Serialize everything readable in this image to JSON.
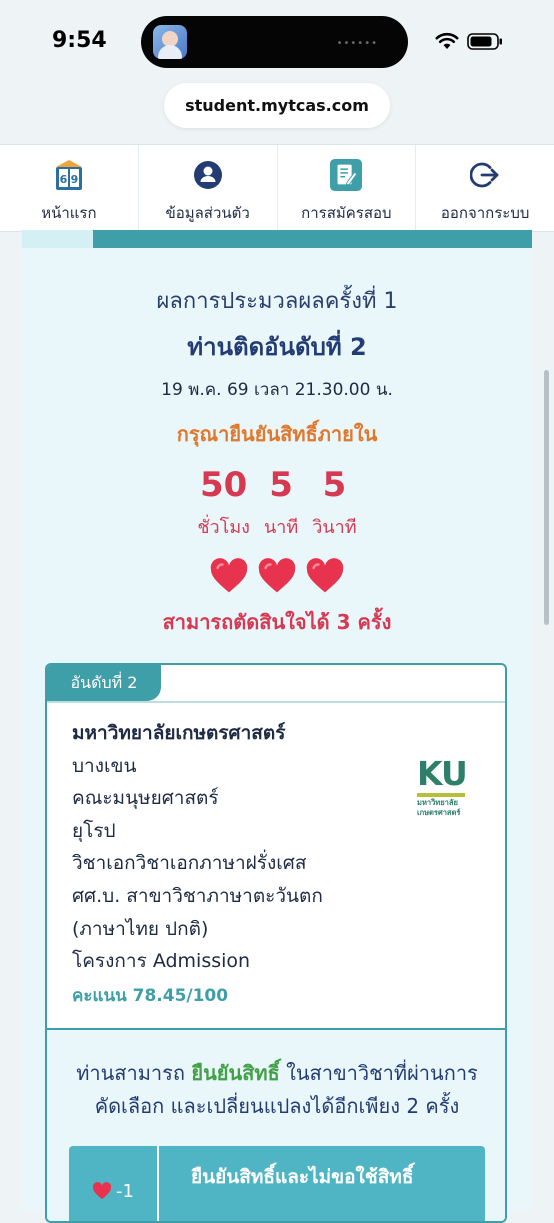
{
  "status_bar": {
    "time": "9:54"
  },
  "browser": {
    "url": "student.mytcas.com"
  },
  "nav": {
    "items": [
      {
        "label": "หน้าแรก",
        "icon": "book-69-icon",
        "badge_left": "6",
        "badge_right": "9"
      },
      {
        "label": "ข้อมูลส่วนตัว",
        "icon": "user-circle-icon"
      },
      {
        "label": "การสมัครสอบ",
        "icon": "edit-document-icon"
      },
      {
        "label": "ออกจากระบบ",
        "icon": "logout-icon"
      }
    ]
  },
  "result": {
    "round_title": "ผลการประมวลผลครั้งที่ 1",
    "rank_title": "ท่านติดอันดับที่ 2",
    "deadline": "19 พ.ค. 69 เวลา 21.30.00 น.",
    "confirm_label": "กรุณายืนยันสิทธิ์ภายใน",
    "countdown": {
      "hours": "50",
      "hours_unit": "ชั่วโมง",
      "minutes": "5",
      "minutes_unit": "นาที",
      "seconds": "5",
      "seconds_unit": "วินาที"
    },
    "hearts_count": 3,
    "chances_text": "สามารถตัดสินใจได้ 3 ครั้ง"
  },
  "card": {
    "rank_tab": "อันดับที่ 2",
    "university": "มหาวิทยาลัยเกษตรศาสตร์",
    "campus": "บางเขน",
    "faculty": "คณะมนุษยศาสตร์",
    "field": "ยุโรป",
    "major": "วิชาเอกวิชาเอกภาษาฝรั่งเศส",
    "degree": "ศศ.บ. สาขาวิชาภาษาตะวันตก",
    "program": "(ภาษาไทย ปกติ)",
    "project": "โครงการ Admission",
    "score": "คะแนน 78.45/100",
    "logo": {
      "letters": "KU",
      "line1": "มหาวิทยาลัย",
      "line2": "เกษตรศาสตร์"
    },
    "info": {
      "before": "ท่านสามารถ ",
      "highlight": "ยืนยันสิทธิ์",
      "after": " ในสาขาวิชาที่ผ่านการ",
      "line2": "คัดเลือก และเปลี่ยนแปลงได้อีกเพียง 2 ครั้ง"
    },
    "action": {
      "cost": "-1",
      "label": "ยืนยันสิทธิ์และไม่ขอใช้สิทธิ์"
    }
  },
  "colors": {
    "teal": "#3f9fa8",
    "red": "#d63a52",
    "orange": "#e0782d",
    "navy": "#233c73",
    "green": "#43a047"
  }
}
